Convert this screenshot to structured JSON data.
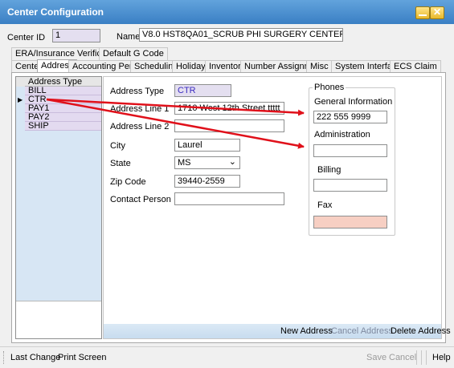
{
  "window": {
    "title": "Center Configuration"
  },
  "header": {
    "center_id_label": "Center ID",
    "center_id_value": "1",
    "name_label": "Name",
    "name_value": "V8.0 HST8QA01_SCRUB PHI SURGERY CENTER"
  },
  "tabs_row1": [
    "ERA/Insurance Verification",
    "Default G Code"
  ],
  "tabs_row2": [
    "Center",
    "Address",
    "Accounting Period",
    "Scheduling",
    "Holidays",
    "Inventory",
    "Number Assignment",
    "Misc",
    "System Interface",
    "ECS Claim"
  ],
  "active_tab": "Address",
  "grid": {
    "header": "Address Type",
    "rows": [
      "BILL",
      "CTR",
      "PAY1",
      "PAY2",
      "SHIP"
    ],
    "selected": "CTR"
  },
  "form": {
    "address_type_label": "Address Type",
    "address_type_value": "CTR",
    "address_line1_label": "Address Line 1",
    "address_line1_value": "1710 West 12th Street ttttt",
    "address_line2_label": "Address Line 2",
    "address_line2_value": "",
    "city_label": "City",
    "city_value": "Laurel",
    "state_label": "State",
    "state_value": "MS",
    "zip_label": "Zip Code",
    "zip_value": "39440-2559",
    "contact_label": "Contact Person",
    "contact_value": ""
  },
  "phones": {
    "legend": "Phones",
    "general_label": "General Information",
    "general_value": "222 555 9999",
    "admin_label": "Administration",
    "admin_value": "",
    "billing_label": "Billing",
    "billing_value": "",
    "fax_label": "Fax",
    "fax_value": ""
  },
  "actions": {
    "new_address": "New Address",
    "cancel_address": "Cancel Address",
    "delete_address": "Delete Address"
  },
  "statusbar": {
    "last_change": "Last Change",
    "print_screen": "Print Screen",
    "save": "Save",
    "cancel": "Cancel",
    "help": "Help"
  },
  "colors": {
    "title_bar": "#3a7fc4",
    "readonly_field": "#e4dff0",
    "fax_field": "#f7cfc3",
    "annotation_arrow": "#e0101a"
  }
}
